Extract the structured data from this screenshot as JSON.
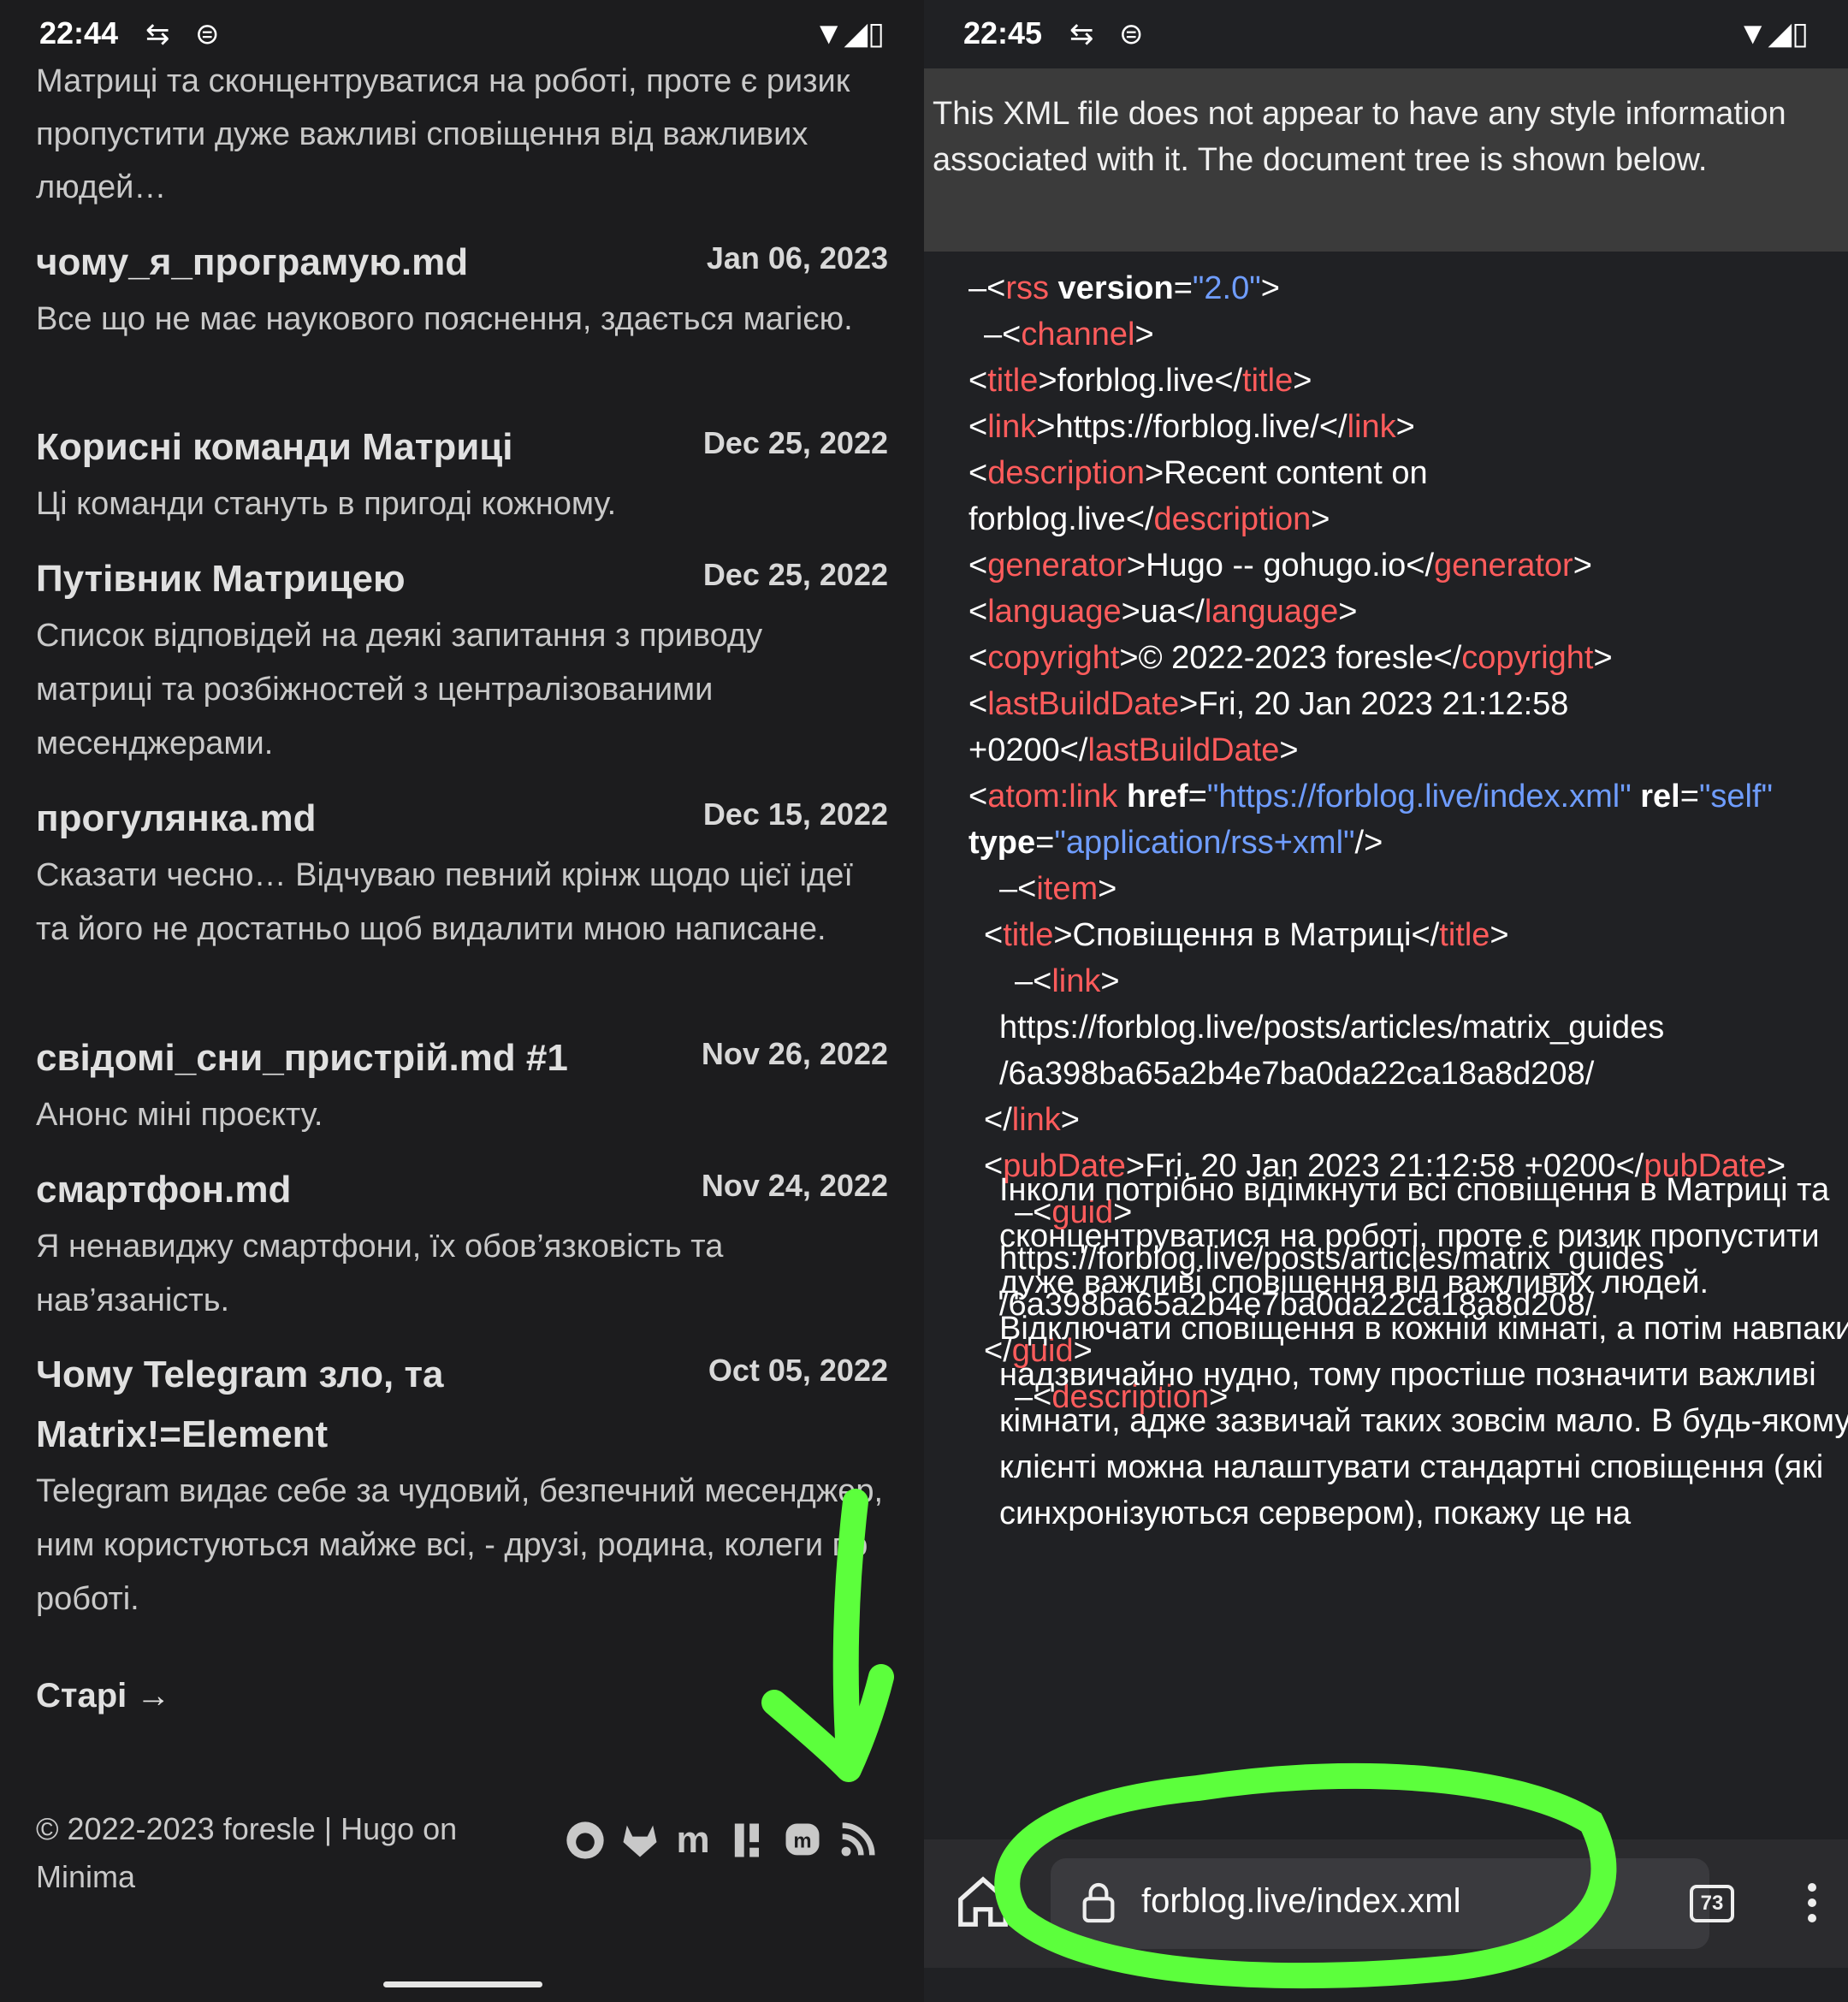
{
  "left": {
    "status": {
      "time": "22:44"
    },
    "intro_text": "Матриці та сконцентруватися на роботі, проте є ризик пропустити дуже важливі сповіщення від важливих людей…",
    "posts": [
      {
        "title": "чому_я_програмую.md",
        "date": "Jan 06, 2023",
        "desc": "Все що не має наукового пояснення, здається магією."
      },
      {
        "title": "Корисні команди Матриці",
        "date": "Dec 25, 2022",
        "desc": "Ці команди стануть в пригоді кожному."
      },
      {
        "title": "Путівник Матрицею",
        "date": "Dec 25, 2022",
        "desc": "Список відповідей на деякі запитання з приводу матриці та розбіжностей з централізованими месенджерами."
      },
      {
        "title": "прогулянка.md",
        "date": "Dec 15, 2022",
        "desc": "Сказати чесно… Відчуваю певний крінж щодо цієї ідеї та його не достатньо щоб видалити мною написане."
      },
      {
        "title": "свідомі_сни_пристрій.md #1",
        "date": "Nov 26, 2022",
        "desc": "Анонс міні проєкту."
      },
      {
        "title": "смартфон.md",
        "date": "Nov 24, 2022",
        "desc": "Я ненавиджу смартфони, їх обов’язковість та нав’язаність."
      },
      {
        "title": "Чому Telegram зло, та Matrix!=Element",
        "date": "Oct 05, 2022",
        "desc": "Telegram видає себе за чудовий, безпечний месенджер, ним користуються майже всі, - друзі, родина, колеги по роботі."
      }
    ],
    "older_link": "Старі →",
    "footer": "© 2022-2023 foresle | Hugo on Minima",
    "social_icons": [
      "github-icon",
      "gitlab-icon",
      "matrix-icon",
      "liberapay-icon",
      "mastodon-icon",
      "rss-icon"
    ]
  },
  "right": {
    "status": {
      "time": "22:45"
    },
    "notice": "This XML file does not appear to have any style information associated with it. The document tree is shown below.",
    "xml": {
      "rss_version": "\"2.0\"",
      "title": "forblog.live",
      "link": "https://forblog.live/",
      "description_1": "Recent content on",
      "description_2": "forblog.live",
      "generator": "Hugo -- gohugo.io",
      "language": "ua",
      "copyright": "© 2022-2023 foresle",
      "lastBuildDate_1": "Fri, 20 Jan 2023 21:12:58",
      "lastBuildDate_2": "+0200",
      "atom_href": "\"https://forblog.live/index.xml\"",
      "atom_rel": "\"self\"",
      "atom_type": "\"application/rss+xml\"",
      "item_title": "Сповіщення в Матриці",
      "item_link_1": "https://forblog.live/posts/articles/matrix_guides",
      "item_link_2": "/6a398ba65a2b4e7ba0da22ca18a8d208/",
      "item_pubDate": "Fri, 20 Jan 2023 21:12:58 +0200",
      "item_guid_1": "https://forblog.live/posts/articles/matrix_guides",
      "item_guid_2": "/6a398ba65a2b4e7ba0da22ca18a8d208/",
      "item_description": "Інколи потрібно відімкнути всі сповіщення в Матриці та сконцентруватися на роботі, проте є ризик пропустити дуже важливі сповіщення від важливих людей. Відключати сповіщення в кожній кімнаті, а потім навпаки надзвичайно нудно, тому простіше позначити важливі кімнати, адже зазвичай таких зовсім мало. В будь-якому клієнті можна налаштувати стандартні сповіщення (які синхронізуються сервером), покажу це на"
    },
    "browser": {
      "url": "forblog.live/index.xml",
      "tab_count": "73"
    }
  },
  "annotation_color": "#5cff3c"
}
